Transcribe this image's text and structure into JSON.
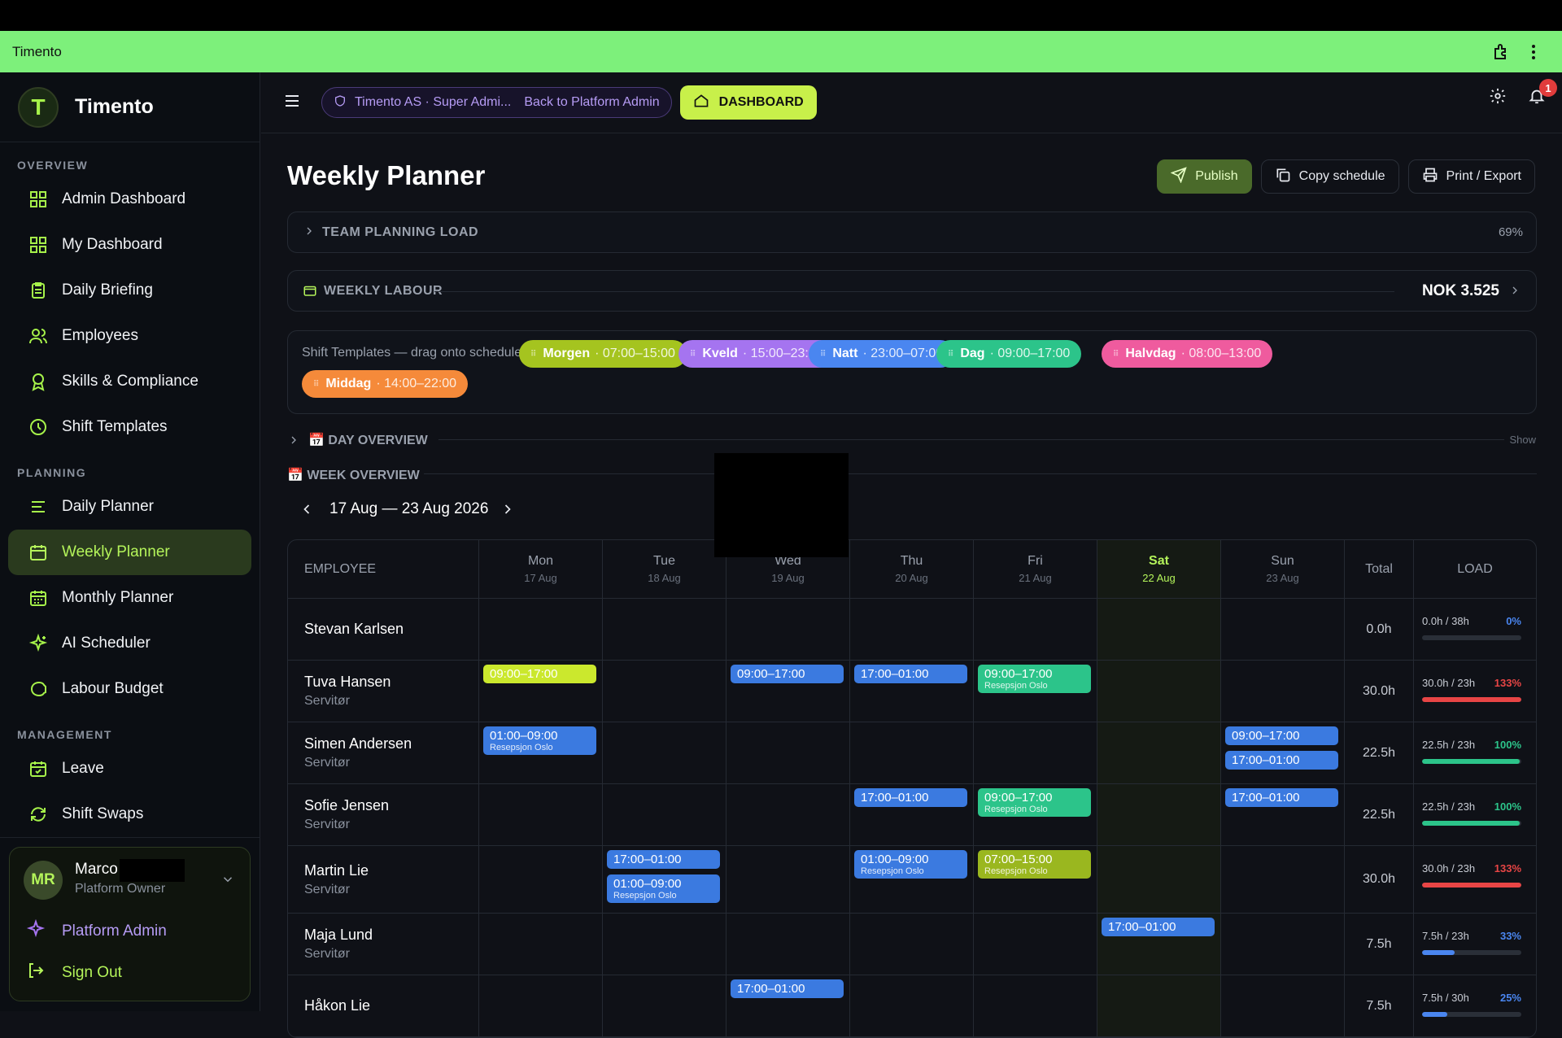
{
  "appbar": {
    "title": "Timento"
  },
  "brand": {
    "name": "Timento",
    "logo_letter": "T"
  },
  "nav": {
    "overview_label": "OVERVIEW",
    "overview": [
      "Admin Dashboard",
      "My Dashboard",
      "Daily Briefing",
      "Employees",
      "Skills & Compliance",
      "Shift Templates"
    ],
    "planning_label": "PLANNING",
    "planning": [
      "Daily Planner",
      "Weekly Planner",
      "Monthly Planner",
      "AI Scheduler",
      "Labour Budget"
    ],
    "management_label": "MANAGEMENT",
    "management": [
      "Leave",
      "Shift Swaps"
    ]
  },
  "user": {
    "initials": "MR",
    "name": "Marco",
    "role": "Platform Owner",
    "platform_admin": "Platform Admin",
    "sign_out": "Sign Out"
  },
  "header": {
    "org": "Timento AS · Super Admi...",
    "back": "Back to Platform Admin",
    "dashboard": "DASHBOARD",
    "notif_count": "1"
  },
  "page": {
    "title": "Weekly Planner",
    "publish": "Publish",
    "copy": "Copy schedule",
    "print": "Print / Export"
  },
  "team_load": {
    "label": "TEAM PLANNING LOAD",
    "value": "69%"
  },
  "labour": {
    "label": "WEEKLY LABOUR",
    "value": "NOK 3.525"
  },
  "templates": {
    "label": "Shift Templates — drag onto schedule",
    "items": [
      {
        "name": "Morgen",
        "time": "· 07:00–15:00",
        "color": "#a5c41f"
      },
      {
        "name": "Kveld",
        "time": "· 15:00–23:00",
        "color": "#a574f0"
      },
      {
        "name": "Natt",
        "time": "· 23:00–07:00",
        "color": "#4a86f0"
      },
      {
        "name": "Dag",
        "time": "· 09:00–17:00",
        "color": "#2cc48a"
      },
      {
        "name": "Halvdag",
        "time": "· 08:00–13:00",
        "color": "#ef5b9e"
      },
      {
        "name": "Middag",
        "time": "· 14:00–22:00",
        "color": "#f58a3a"
      }
    ]
  },
  "day_overview": {
    "label": "📅 DAY OVERVIEW",
    "show": "Show"
  },
  "week_overview": {
    "label": "📅 WEEK OVERVIEW",
    "range": "17 Aug — 23 Aug 2026"
  },
  "table": {
    "emp_header": "EMPLOYEE",
    "total_header": "Total",
    "load_header": "LOAD",
    "days": [
      {
        "d": "Mon",
        "s": "17 Aug"
      },
      {
        "d": "Tue",
        "s": "18 Aug"
      },
      {
        "d": "Wed",
        "s": "19 Aug"
      },
      {
        "d": "Thu",
        "s": "20 Aug"
      },
      {
        "d": "Fri",
        "s": "21 Aug"
      },
      {
        "d": "Sat",
        "s": "22 Aug"
      },
      {
        "d": "Sun",
        "s": "23 Aug"
      }
    ],
    "rows": [
      {
        "name": "Stevan Karlsen",
        "role": "",
        "total": "0.0h",
        "load": "0.0h / 38h",
        "pct": "0%",
        "pct_value": 0,
        "pct_color": "#4a86f0",
        "h": 76,
        "shifts": []
      },
      {
        "name": "Tuva Hansen",
        "role": "Servitør",
        "total": "30.0h",
        "load": "30.0h / 23h",
        "pct": "133%",
        "pct_value": 100,
        "pct_color": "#e84545",
        "h": 76,
        "shifts": [
          {
            "day": 0,
            "time": "09:00–17:00",
            "loc": "",
            "c": "lime",
            "slot": 0
          },
          {
            "day": 2,
            "time": "09:00–17:00",
            "loc": "",
            "c": "blue",
            "slot": 0
          },
          {
            "day": 3,
            "time": "17:00–01:00",
            "loc": "",
            "c": "blue",
            "slot": 0
          },
          {
            "day": 4,
            "time": "09:00–17:00",
            "loc": "Resepsjon Oslo",
            "c": "green",
            "slot": 0
          }
        ]
      },
      {
        "name": "Simen Andersen",
        "role": "Servitør",
        "total": "22.5h",
        "load": "22.5h / 23h",
        "pct": "100%",
        "pct_value": 98,
        "pct_color": "#2cc48a",
        "h": 76,
        "shifts": [
          {
            "day": 0,
            "time": "01:00–09:00",
            "loc": "Resepsjon Oslo",
            "c": "blue",
            "slot": 0
          },
          {
            "day": 6,
            "time": "09:00–17:00",
            "loc": "",
            "c": "blue",
            "slot": 0
          },
          {
            "day": 6,
            "time": "17:00–01:00",
            "loc": "",
            "c": "blue",
            "slot": 1
          }
        ]
      },
      {
        "name": "Sofie Jensen",
        "role": "Servitør",
        "total": "22.5h",
        "load": "22.5h / 23h",
        "pct": "100%",
        "pct_value": 98,
        "pct_color": "#2cc48a",
        "h": 76,
        "shifts": [
          {
            "day": 3,
            "time": "17:00–01:00",
            "loc": "",
            "c": "blue",
            "slot": 0
          },
          {
            "day": 4,
            "time": "09:00–17:00",
            "loc": "Resepsjon Oslo",
            "c": "green",
            "slot": 0
          },
          {
            "day": 6,
            "time": "17:00–01:00",
            "loc": "",
            "c": "blue",
            "slot": 0
          }
        ]
      },
      {
        "name": "Martin Lie",
        "role": "Servitør",
        "total": "30.0h",
        "load": "30.0h / 23h",
        "pct": "133%",
        "pct_value": 100,
        "pct_color": "#e84545",
        "h": 83,
        "shifts": [
          {
            "day": 1,
            "time": "17:00–01:00",
            "loc": "",
            "c": "blue",
            "slot": 0
          },
          {
            "day": 1,
            "time": "01:00–09:00",
            "loc": "Resepsjon Oslo",
            "c": "blue",
            "slot": 1
          },
          {
            "day": 3,
            "time": "01:00–09:00",
            "loc": "Resepsjon Oslo",
            "c": "blue",
            "slot": 0
          },
          {
            "day": 4,
            "time": "07:00–15:00",
            "loc": "Resepsjon Oslo",
            "c": "olive",
            "slot": 0
          }
        ]
      },
      {
        "name": "Maja Lund",
        "role": "Servitør",
        "total": "7.5h",
        "load": "7.5h / 23h",
        "pct": "33%",
        "pct_value": 33,
        "pct_color": "#4a86f0",
        "h": 76,
        "shifts": [
          {
            "day": 5,
            "time": "17:00–01:00",
            "loc": "",
            "c": "blue",
            "slot": 0
          }
        ]
      },
      {
        "name": "Håkon Lie",
        "role": "",
        "total": "7.5h",
        "load": "7.5h / 30h",
        "pct": "25%",
        "pct_value": 25,
        "pct_color": "#4a86f0",
        "h": 76,
        "shifts": [
          {
            "day": 2,
            "time": "17:00–01:00",
            "loc": "",
            "c": "blue",
            "slot": 0
          }
        ]
      }
    ]
  }
}
